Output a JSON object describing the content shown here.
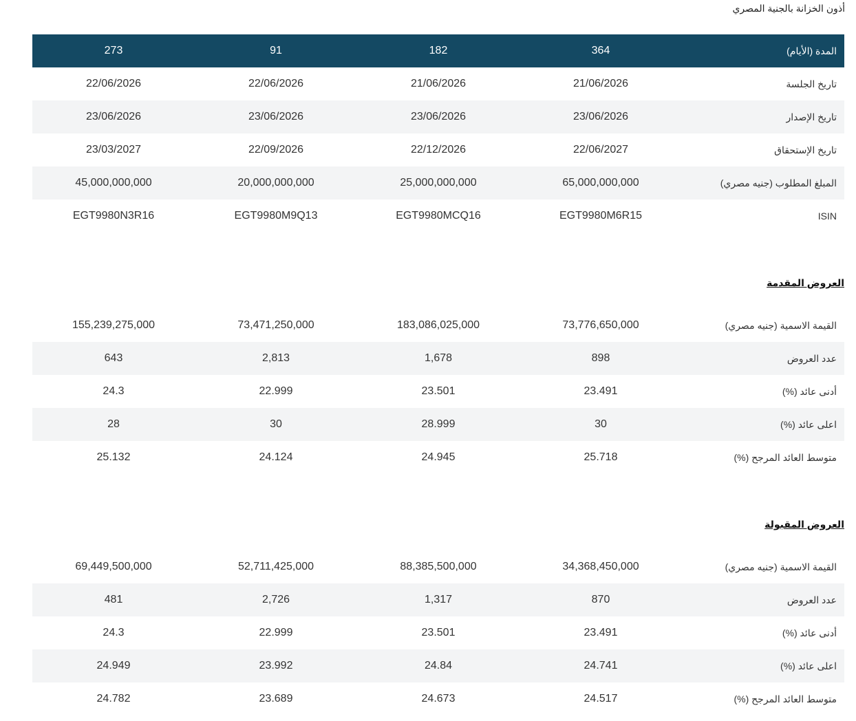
{
  "title": "أذون الخزانة بالجنية المصري",
  "issue": {
    "header": {
      "label": "المدة (الأيام)",
      "values": [
        "364",
        "182",
        "91",
        "273"
      ]
    },
    "rows": [
      {
        "label": "تاريخ الجلسة",
        "values": [
          "21/06/2026",
          "21/06/2026",
          "22/06/2026",
          "22/06/2026"
        ]
      },
      {
        "label": "تاريخ الإصدار",
        "values": [
          "23/06/2026",
          "23/06/2026",
          "23/06/2026",
          "23/06/2026"
        ]
      },
      {
        "label": "تاريخ الإستحقاق",
        "values": [
          "22/06/2027",
          "22/12/2026",
          "22/09/2026",
          "23/03/2027"
        ]
      },
      {
        "label": "المبلغ المطلوب (جنيه مصري)",
        "values": [
          "65,000,000,000",
          "25,000,000,000",
          "20,000,000,000",
          "45,000,000,000"
        ]
      },
      {
        "label": "ISIN",
        "values": [
          "EGT9980M6R15",
          "EGT9980MCQ16",
          "EGT9980M9Q13",
          "EGT9980N3R16"
        ]
      }
    ]
  },
  "submitted": {
    "title": "العروض المقدمة",
    "rows": [
      {
        "label": "القيمة الاسمية (جنيه مصري)",
        "values": [
          "73,776,650,000",
          "183,086,025,000",
          "73,471,250,000",
          "155,239,275,000"
        ]
      },
      {
        "label": "عدد العروض",
        "values": [
          "898",
          "1,678",
          "2,813",
          "643"
        ]
      },
      {
        "label": "أدنى عائد (%)",
        "values": [
          "23.491",
          "23.501",
          "22.999",
          "24.3"
        ]
      },
      {
        "label": "اعلى عائد (%)",
        "values": [
          "30",
          "28.999",
          "30",
          "28"
        ]
      },
      {
        "label": "متوسط العائد المرجح (%)",
        "values": [
          "25.718",
          "24.945",
          "24.124",
          "25.132"
        ]
      }
    ]
  },
  "accepted": {
    "title": "العروض المقبولة",
    "rows": [
      {
        "label": "القيمة الاسمية (جنيه مصري)",
        "values": [
          "34,368,450,000",
          "88,385,500,000",
          "52,711,425,000",
          "69,449,500,000"
        ]
      },
      {
        "label": "عدد العروض",
        "values": [
          "870",
          "1,317",
          "2,726",
          "481"
        ]
      },
      {
        "label": "أدنى عائد (%)",
        "values": [
          "23.491",
          "23.501",
          "22.999",
          "24.3"
        ]
      },
      {
        "label": "اعلى عائد (%)",
        "values": [
          "24.741",
          "24.84",
          "23.992",
          "24.949"
        ]
      },
      {
        "label": "متوسط العائد المرجح (%)",
        "values": [
          "24.517",
          "24.673",
          "23.689",
          "24.782"
        ]
      }
    ]
  },
  "colors": {
    "header_bg": "#144963",
    "alt_row_bg": "#f3f4f5"
  }
}
